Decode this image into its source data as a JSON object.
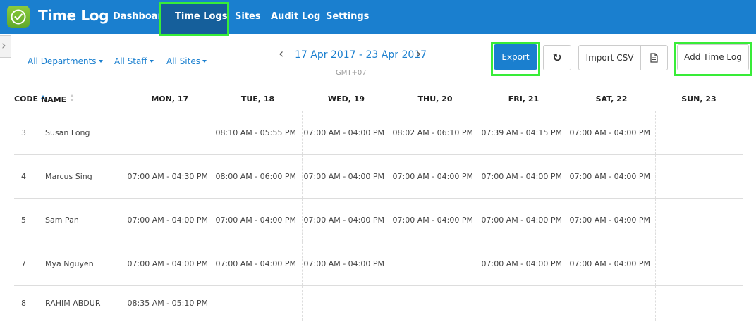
{
  "app": {
    "brand": "Time Log",
    "accent": "#1a7fcf",
    "highlight": "#38ec38",
    "icon": "check-circle-icon"
  },
  "nav": {
    "dashboard": "Dashboard",
    "time_logs": "Time Logs",
    "sites": "Sites",
    "audit_log": "Audit Log",
    "settings": "Settings",
    "active": "Time Logs"
  },
  "filters": {
    "departments": "All Departments",
    "staff": "All Staff",
    "sites": "All Sites"
  },
  "date_nav": {
    "range": "17 Apr 2017 - 23 Apr 2017",
    "timezone": "GMT+07"
  },
  "actions": {
    "export": "Export",
    "refresh_icon": "refresh-icon",
    "import_csv": "Import CSV",
    "file_icon": "document-icon",
    "add_time_log": "Add Time Log"
  },
  "table": {
    "headers": {
      "code": "CODE",
      "name": "NAME",
      "days": [
        "MON, 17",
        "TUE, 18",
        "WED, 19",
        "THU, 20",
        "FRI, 21",
        "SAT, 22",
        "SUN, 23"
      ]
    },
    "rows": [
      {
        "code": "3",
        "name": "Susan Long",
        "days": [
          "",
          "08:10 AM - 05:55 PM",
          "07:00 AM - 04:00 PM",
          "08:02 AM - 06:10 PM",
          "07:39 AM - 04:15 PM",
          "07:00 AM - 04:00 PM",
          ""
        ]
      },
      {
        "code": "4",
        "name": "Marcus Sing",
        "days": [
          "07:00 AM - 04:30 PM",
          "08:00 AM - 06:00 PM",
          "07:00 AM - 04:00 PM",
          "07:00 AM - 04:00 PM",
          "07:00 AM - 04:00 PM",
          "07:00 AM - 04:00 PM",
          ""
        ]
      },
      {
        "code": "5",
        "name": "Sam Pan",
        "days": [
          "07:00 AM - 04:00 PM",
          "07:00 AM - 04:00 PM",
          "07:00 AM - 04:00 PM",
          "07:00 AM - 04:00 PM",
          "07:00 AM - 04:00 PM",
          "07:00 AM - 04:00 PM",
          ""
        ]
      },
      {
        "code": "7",
        "name": "Mya Nguyen",
        "days": [
          "07:00 AM - 04:00 PM",
          "07:00 AM - 04:00 PM",
          "07:00 AM - 04:00 PM",
          "",
          "07:00 AM - 04:00 PM",
          "07:00 AM - 04:00 PM",
          ""
        ]
      },
      {
        "code": "8",
        "name": "RAHIM ABDUR",
        "days": [
          "08:35 AM - 05:10 PM",
          "",
          "",
          "",
          "",
          "",
          ""
        ]
      }
    ]
  }
}
